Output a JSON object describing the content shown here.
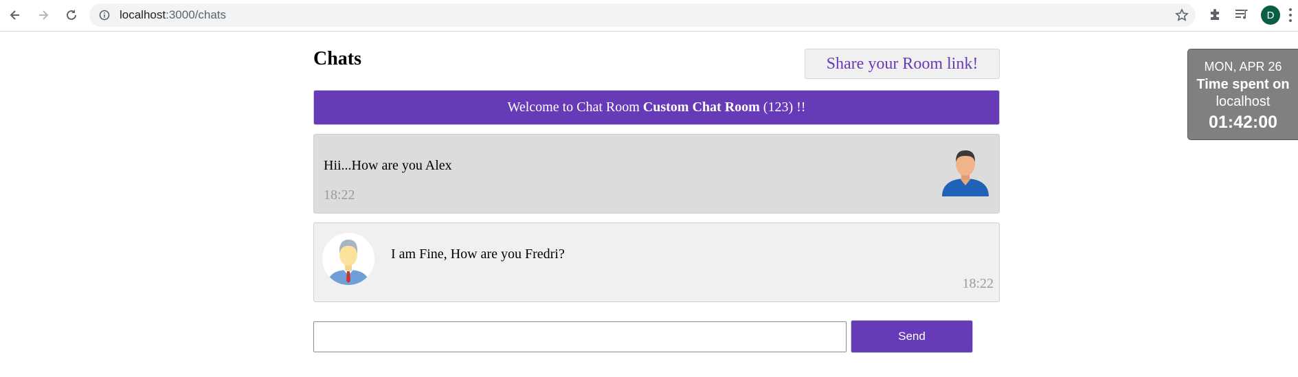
{
  "browser": {
    "url_host": "localhost",
    "url_path": ":3000/chats",
    "profile_initial": "D"
  },
  "page": {
    "title": "Chats",
    "share_label": "Share your Room link!",
    "welcome": {
      "prefix": "Welcome to Chat Room",
      "room_name": "Custom Chat Room",
      "suffix": "(123) !!"
    }
  },
  "messages": [
    {
      "text": "Hii...How are you Alex",
      "time": "18:22"
    },
    {
      "text": "I am Fine, How are you Fredri?",
      "time": "18:22"
    }
  ],
  "composer": {
    "value": "",
    "send_label": "Send"
  },
  "timer_widget": {
    "date": "MON, APR 26",
    "line1": "Time spent on",
    "line2": "localhost",
    "elapsed": "01:42:00"
  },
  "colors": {
    "accent": "#673ab7",
    "message_received_bg": "#dcdcdc",
    "message_sent_bg": "#f0f0f0",
    "timer_bg": "#808080"
  }
}
